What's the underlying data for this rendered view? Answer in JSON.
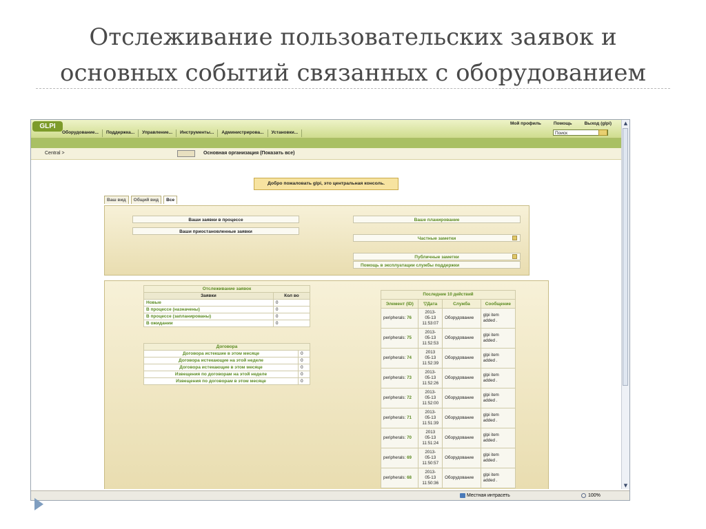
{
  "slide": {
    "title_line1": "Отслеживание пользовательских заявок и",
    "title_line2": "основных событий связанных с оборудованием"
  },
  "glpi": {
    "logo": "GLPI",
    "menu": [
      "Оборудование...",
      "Поддержка...",
      "Управление...",
      "Инструменты...",
      "Администрирова...",
      "Установки..."
    ],
    "top_links": {
      "profile": "Мой профиль",
      "help": "Помощь",
      "logout": "Выход (glpi)"
    },
    "search_value": "Поиск",
    "breadcrumb": "Central >",
    "entity": "Основная организация (Показать все)",
    "welcome": "Добро пожаловать glpi, это центральная консоль.",
    "tabs": [
      "Ваш вид",
      "Общий вид",
      "Все"
    ],
    "panel_top": {
      "my_tickets_progress": "Ваши заявки в процессе",
      "my_tickets_pending": "Ваши приостановленные заявки",
      "planning": "Ваше планирование",
      "private_notes": "Частные заметки",
      "public_notes": "Публичные заметки",
      "helpdesk_help": "Помощь в эксплуатации службы поддержки"
    },
    "tracking": {
      "caption": "Отслеживание заявок",
      "col_tickets": "Заявки",
      "col_count": "Кол во",
      "rows": [
        {
          "label": "Новые",
          "count": "0"
        },
        {
          "label": "В процессе (назначены)",
          "count": "0"
        },
        {
          "label": "В процессе (запланированы)",
          "count": "0"
        },
        {
          "label": "В ожидании",
          "count": "0"
        }
      ]
    },
    "contracts": {
      "caption": "Договора",
      "rows": [
        {
          "label": "Договора истекшие в этом месяце",
          "count": "0"
        },
        {
          "label": "Договора истекающие на этой неделе",
          "count": "0"
        },
        {
          "label": "Договора истекающие в этом месяце",
          "count": "0"
        },
        {
          "label": "Извещения по договорам на этой неделе",
          "count": "0"
        },
        {
          "label": "Извещения по договорам в этом месяце",
          "count": "0"
        }
      ]
    },
    "events": {
      "caption": "Последние 10 действий",
      "headers": [
        "Элемент (ID)",
        "Дата",
        "Служба",
        "Сообщение"
      ],
      "rows": [
        {
          "item": "peripherals:",
          "id": "76",
          "date1": "2013-",
          "date2": "05-13",
          "time": "11:53:07",
          "service": "Оборудование",
          "msg1": "glpi item",
          "msg2": "added ."
        },
        {
          "item": "peripherals:",
          "id": "75",
          "date1": "2013-",
          "date2": "05-13",
          "time": "11:52:53",
          "service": "Оборудование",
          "msg1": "glpi item",
          "msg2": "added ."
        },
        {
          "item": "peripherals:",
          "id": "74",
          "date1": "2013",
          "date2": "05-13",
          "time": "11:52:39",
          "service": "Оборудование",
          "msg1": "glpi item",
          "msg2": "added ."
        },
        {
          "item": "peripherals:",
          "id": "73",
          "date1": "2013-",
          "date2": "05-13",
          "time": "11:52:26",
          "service": "Оборудование",
          "msg1": "glpi item",
          "msg2": "added ."
        },
        {
          "item": "peripherals:",
          "id": "72",
          "date1": "2013-",
          "date2": "05-13",
          "time": "11:52:00",
          "service": "Оборудование",
          "msg1": "glpi item",
          "msg2": "added ."
        },
        {
          "item": "peripherals:",
          "id": "71",
          "date1": "2013-",
          "date2": "05-13",
          "time": "11:51:39",
          "service": "Оборудование",
          "msg1": "glpi item",
          "msg2": "added ."
        },
        {
          "item": "peripherals:",
          "id": "70",
          "date1": "2013",
          "date2": "05-13",
          "time": "11:51:24",
          "service": "Оборудование",
          "msg1": "glpi item",
          "msg2": "added ."
        },
        {
          "item": "peripherals:",
          "id": "69",
          "date1": "2013-",
          "date2": "05-13",
          "time": "11:50:57",
          "service": "Оборудование",
          "msg1": "glpi item",
          "msg2": "added ."
        },
        {
          "item": "peripherals:",
          "id": "68",
          "date1": "2013-",
          "date2": "05-13",
          "time": "11:50:36",
          "service": "Оборудование",
          "msg1": "glpi item",
          "msg2": "added ."
        }
      ]
    }
  },
  "statusbar": {
    "zone": "Местная интрасеть",
    "zoom": "100%"
  }
}
